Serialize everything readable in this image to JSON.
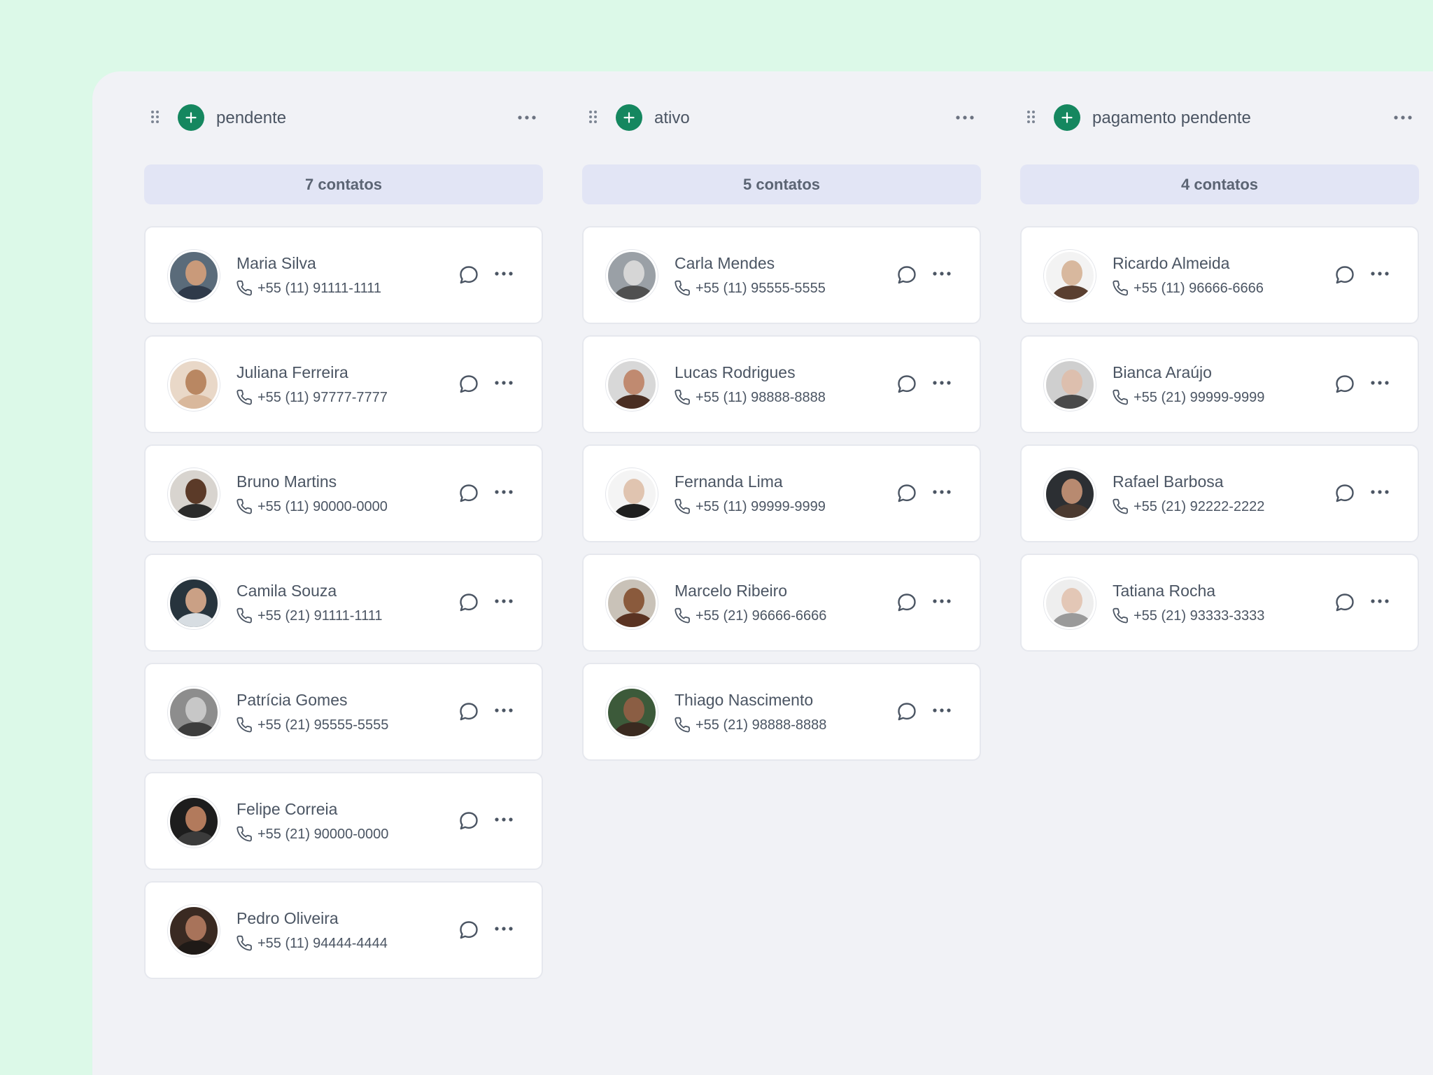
{
  "columns": [
    {
      "title": "pendente",
      "count_label": "7 contatos",
      "contacts": [
        {
          "name": "Maria Silva",
          "phone": "+55 (11) 91111-1111",
          "avatar_bg": "#5a6b7a",
          "avatar_skin": "#c99a7a",
          "avatar_shirt": "#2f3a4a"
        },
        {
          "name": "Juliana Ferreira",
          "phone": "+55 (11) 97777-7777",
          "avatar_bg": "#e9d8c8",
          "avatar_skin": "#b98762",
          "avatar_shirt": "#d9b89c"
        },
        {
          "name": "Bruno Martins",
          "phone": "+55 (11) 90000-0000",
          "avatar_bg": "#d8d4cf",
          "avatar_skin": "#5b3a28",
          "avatar_shirt": "#2b2b2b"
        },
        {
          "name": "Camila Souza",
          "phone": "+55 (21) 91111-1111",
          "avatar_bg": "#27343d",
          "avatar_skin": "#caa085",
          "avatar_shirt": "#d7dde2"
        },
        {
          "name": "Patrícia Gomes",
          "phone": "+55 (21) 95555-5555",
          "avatar_bg": "#8d8d8d",
          "avatar_skin": "#c7c7c7",
          "avatar_shirt": "#3d3d3d"
        },
        {
          "name": "Felipe Correia",
          "phone": "+55 (21) 90000-0000",
          "avatar_bg": "#1d1d1d",
          "avatar_skin": "#b27a5c",
          "avatar_shirt": "#3b3b3b"
        },
        {
          "name": "Pedro Oliveira",
          "phone": "+55 (11) 94444-4444",
          "avatar_bg": "#3a2a22",
          "avatar_skin": "#a8735a",
          "avatar_shirt": "#1f1a17"
        }
      ]
    },
    {
      "title": "ativo",
      "count_label": "5 contatos",
      "contacts": [
        {
          "name": "Carla Mendes",
          "phone": "+55 (11) 95555-5555",
          "avatar_bg": "#9aa0a6",
          "avatar_skin": "#d6d6d6",
          "avatar_shirt": "#505050"
        },
        {
          "name": "Lucas Rodrigues",
          "phone": "+55 (11) 98888-8888",
          "avatar_bg": "#d8d8d8",
          "avatar_skin": "#c08a70",
          "avatar_shirt": "#4a2e22"
        },
        {
          "name": "Fernanda Lima",
          "phone": "+55 (11) 99999-9999",
          "avatar_bg": "#f4f4f4",
          "avatar_skin": "#e0c4b0",
          "avatar_shirt": "#1f1f1f"
        },
        {
          "name": "Marcelo Ribeiro",
          "phone": "+55 (21) 96666-6666",
          "avatar_bg": "#c9c2b8",
          "avatar_skin": "#8a5a3c",
          "avatar_shirt": "#5a3322"
        },
        {
          "name": "Thiago Nascimento",
          "phone": "+55 (21) 98888-8888",
          "avatar_bg": "#3c5a3a",
          "avatar_skin": "#8b5e44",
          "avatar_shirt": "#3a2a20"
        }
      ]
    },
    {
      "title": "pagamento pendente",
      "count_label": "4 contatos",
      "contacts": [
        {
          "name": "Ricardo Almeida",
          "phone": "+55 (11) 96666-6666",
          "avatar_bg": "#f3f3f3",
          "avatar_skin": "#d8b89e",
          "avatar_shirt": "#5a3f30"
        },
        {
          "name": "Bianca Araújo",
          "phone": "+55 (21) 99999-9999",
          "avatar_bg": "#cfcfcf",
          "avatar_skin": "#ddbfae",
          "avatar_shirt": "#4a4a4a"
        },
        {
          "name": "Rafael Barbosa",
          "phone": "+55 (21) 92222-2222",
          "avatar_bg": "#2c2f33",
          "avatar_skin": "#b88a70",
          "avatar_shirt": "#4b3a30"
        },
        {
          "name": "Tatiana Rocha",
          "phone": "+55 (21) 93333-3333",
          "avatar_bg": "#eeeeee",
          "avatar_skin": "#e3c7b6",
          "avatar_shirt": "#9a9a9a"
        }
      ]
    }
  ],
  "icons": {
    "column_handle": "drag-handle-icon",
    "column_add": "plus-icon",
    "menu": "more-horizontal-icon",
    "phone": "phone-icon",
    "chat": "message-circle-icon"
  },
  "colors": {
    "accent": "#15875f",
    "page_background": "#dcf9e8",
    "board_background": "#f1f2f6",
    "count_pill": "#e2e5f5"
  }
}
